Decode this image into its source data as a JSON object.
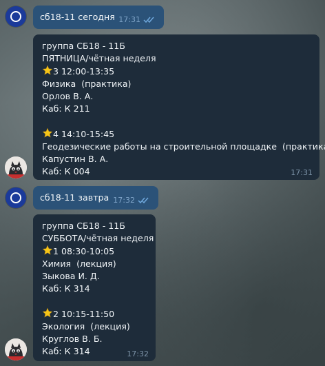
{
  "messages": [
    {
      "type": "outgoing",
      "text": "сб18-11 сегодня",
      "time": "17:31",
      "read_icon": "double-check-icon"
    },
    {
      "type": "incoming",
      "header": [
        "группа СБ18 - 11Б",
        "ПЯТНИЦА/чётная неделя"
      ],
      "lessons": [
        {
          "icon": "star-icon",
          "slot": "3 12:00-13:35",
          "subject": "Физика  (практика)",
          "teacher": "Орлов В. А.",
          "room": "Каб: К 211"
        },
        {
          "icon": "star-icon",
          "slot": "4 14:10-15:45",
          "subject": "Геодезические работы на строительной площадке  (практика)",
          "teacher": "Капустин В. А.",
          "room": "Каб: К 004"
        }
      ],
      "time": "17:31"
    },
    {
      "type": "outgoing",
      "text": "сб18-11 завтра",
      "time": "17:32",
      "read_icon": "double-check-icon"
    },
    {
      "type": "incoming",
      "header": [
        "группа СБ18 - 11Б",
        "СУББОТА/чётная неделя"
      ],
      "lessons": [
        {
          "icon": "star-icon",
          "slot": "1 08:30-10:05",
          "subject": "Химия  (лекция)",
          "teacher": "Зыкова И. Д.",
          "room": "Каб: К 314"
        },
        {
          "icon": "star-icon",
          "slot": "2 10:15-11:50",
          "subject": "Экология  (лекция)",
          "teacher": "Круглов В. Б.",
          "room": "Каб: К 314"
        }
      ],
      "time": "17:32"
    }
  ],
  "colors": {
    "outgoing_bubble": "#2b5278",
    "incoming_bubble": "#1e2c3a",
    "user_avatar": "#1b3a9a",
    "star": "#f5c518"
  }
}
